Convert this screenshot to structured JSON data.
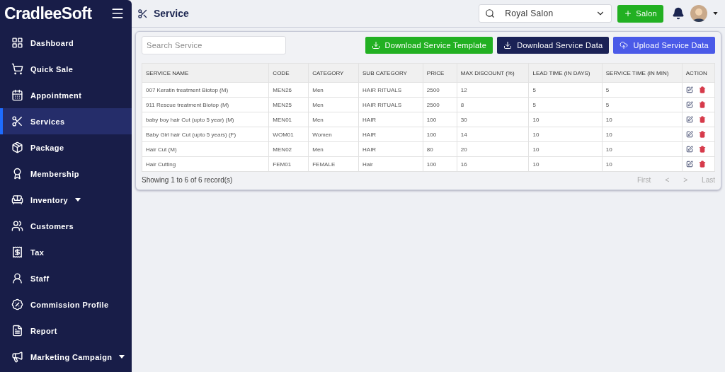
{
  "sidebar": {
    "logo": "CradleeSoft",
    "items": [
      {
        "label": "Dashboard",
        "selected": false,
        "has_submenu": false
      },
      {
        "label": "Quick Sale",
        "selected": false,
        "has_submenu": false
      },
      {
        "label": "Appointment",
        "selected": false,
        "has_submenu": false
      },
      {
        "label": "Services",
        "selected": true,
        "has_submenu": false
      },
      {
        "label": "Package",
        "selected": false,
        "has_submenu": false
      },
      {
        "label": "Membership",
        "selected": false,
        "has_submenu": false
      },
      {
        "label": "Inventory",
        "selected": false,
        "has_submenu": true
      },
      {
        "label": "Customers",
        "selected": false,
        "has_submenu": false
      },
      {
        "label": "Tax",
        "selected": false,
        "has_submenu": false
      },
      {
        "label": "Staff",
        "selected": false,
        "has_submenu": false
      },
      {
        "label": "Commission Profile",
        "selected": false,
        "has_submenu": false
      },
      {
        "label": "Report",
        "selected": false,
        "has_submenu": false
      },
      {
        "label": "Marketing Campaign",
        "selected": false,
        "has_submenu": true
      }
    ]
  },
  "header": {
    "title": "Service",
    "salon_select": "Royal Salon",
    "add_button": "Salon"
  },
  "toolbar": {
    "search_placeholder": "Search Service",
    "buttons": [
      {
        "label": "Download Service Template",
        "kind": "template"
      },
      {
        "label": "Download Service Data",
        "kind": "download"
      },
      {
        "label": "Upload Service Data",
        "kind": "upload"
      }
    ]
  },
  "table": {
    "columns": [
      "SERVICE NAME",
      "CODE",
      "CATEGORY",
      "SUB CATEGORY",
      "PRICE",
      "MAX DISCOUNT (%)",
      "LEAD TIME (IN DAYS)",
      "SERVICE TIME (IN MIN)",
      "ACTION"
    ],
    "rows": [
      [
        "007 Keratin treatment Biotop (M)",
        "MEN26",
        "Men",
        "HAIR RITUALS",
        "2500",
        "12",
        "5",
        "5"
      ],
      [
        "911 Rescue treatment Biotop (M)",
        "MEN25",
        "Men",
        "HAIR RITUALS",
        "2500",
        "8",
        "5",
        "5"
      ],
      [
        "baby boy hair Cut (upto 5 year) (M)",
        "MEN01",
        "Men",
        "HAIR",
        "100",
        "30",
        "10",
        "10"
      ],
      [
        "Baby Girl hair Cut (upto 5 years) (F)",
        "WOM01",
        "Women",
        "HAIR",
        "100",
        "14",
        "10",
        "10"
      ],
      [
        "Hair Cut (M)",
        "MEN02",
        "Men",
        "HAIR",
        "80",
        "20",
        "10",
        "10"
      ],
      [
        "Hair Cutting",
        "FEM01",
        "FEMALE",
        "Hair",
        "100",
        "16",
        "10",
        "10"
      ]
    ]
  },
  "footer": {
    "summary": "Showing 1 to 6 of 6 record(s)",
    "pagination": [
      "First",
      "<",
      ">",
      "Last"
    ]
  }
}
